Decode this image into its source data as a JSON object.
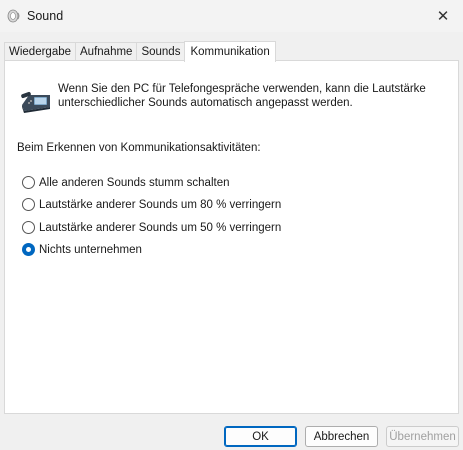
{
  "window": {
    "title": "Sound",
    "icon": "speaker-app-icon"
  },
  "tabs": [
    {
      "label": "Wiedergabe",
      "active": false
    },
    {
      "label": "Aufnahme",
      "active": false
    },
    {
      "label": "Sounds",
      "active": false
    },
    {
      "label": "Kommunikation",
      "active": true
    }
  ],
  "panel": {
    "intro_line1": "Wenn Sie den PC für Telefongespräche verwenden, kann die Lautstärke",
    "intro_line2": "unterschiedlicher Sounds automatisch angepasst werden.",
    "section_label": "Beim Erkennen von Kommunikationsaktivitäten:",
    "options": [
      {
        "label": "Alle anderen Sounds stumm schalten",
        "checked": false
      },
      {
        "label": "Lautstärke anderer Sounds um 80 % verringern",
        "checked": false
      },
      {
        "label": "Lautstärke anderer Sounds um 50 % verringern",
        "checked": false
      },
      {
        "label": "Nichts unternehmen",
        "checked": true
      }
    ]
  },
  "buttons": {
    "ok": "OK",
    "cancel": "Abbrechen",
    "apply": "Übernehmen"
  },
  "colors": {
    "accent": "#0067c0"
  }
}
